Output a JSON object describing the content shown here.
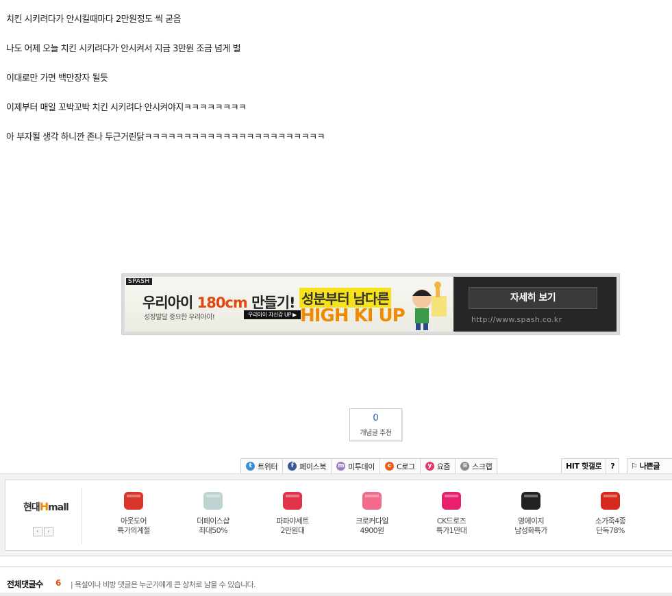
{
  "post": {
    "lines": [
      "치킨 시키려다가 안시킬때마다 2만원정도 씩 굳음",
      "나도 어제 오늘 치킨 시키려다가 안시켜서 지금 3만원 조금 넘게 벌",
      "이대로만 가면 백만장자 될듯",
      "이제부터 매일 꼬박꼬박 치킨 시키려다 안시켜야지ㅋㅋㅋㅋㅋㅋㅋㅋ",
      "아 부자될 생각 하니깐 존나 두근거린닭ㅋㅋㅋㅋㅋㅋㅋㅋㅋㅋㅋㅋㅋㅋㅋㅋㅋㅋㅋㅋㅋㅋㅋ"
    ]
  },
  "ad": {
    "logo": "SPASH",
    "headline_a": "우리아이 ",
    "headline_hl": "180cm",
    "headline_b": " 만들기!",
    "sub": "성장발달 중요한 우리아이!",
    "pill": "우리아이 자신감 UP ▶",
    "slogan": "성분부터 남다른",
    "brand_line": "HIGH KI UP",
    "cta": "자세히 보기",
    "url": "http://www.spash.co.kr"
  },
  "recommend": {
    "count": "0",
    "label": "개념글 추천"
  },
  "share": [
    {
      "label": "트위터",
      "icon": "twitter-icon",
      "color": "#3a8fd6",
      "glyph": "t"
    },
    {
      "label": "페이스북",
      "icon": "facebook-icon",
      "color": "#3b5998",
      "glyph": "f"
    },
    {
      "label": "미투데이",
      "icon": "me2day-icon",
      "color": "#9b7fc4",
      "glyph": "m"
    },
    {
      "label": "C로그",
      "icon": "clog-icon",
      "color": "#e5611c",
      "glyph": "c"
    },
    {
      "label": "요즘",
      "icon": "yozm-icon",
      "color": "#e23a6a",
      "glyph": "y"
    },
    {
      "label": "스크랩",
      "icon": "scrap-icon",
      "color": "#8a8a8a",
      "glyph": "≡"
    }
  ],
  "hit": {
    "gallery": "HIT 힛갤로",
    "help": "?"
  },
  "report": {
    "label": "나쁜글"
  },
  "mall": {
    "brand_a": "현대",
    "brand_h": "H",
    "brand_b": "mall",
    "prev": "‹",
    "next": "›",
    "products": [
      {
        "line1": "아웃도어",
        "line2": "특가의계절",
        "color": "#d8362b",
        "icon": "shoe-icon"
      },
      {
        "line1": "더페이스샵",
        "line2": "최대50%",
        "color": "#bfd3d3",
        "icon": "cosmetic-jar-icon"
      },
      {
        "line1": "파파야세트",
        "line2": "2만원대",
        "color": "#e0334a",
        "icon": "shirt-icon"
      },
      {
        "line1": "크로커다일",
        "line2": "4900원",
        "color": "#f26b8a",
        "icon": "tshirt-icon"
      },
      {
        "line1": "CK드로즈",
        "line2": "특가1만대",
        "color": "#e8206c",
        "icon": "underwear-icon"
      },
      {
        "line1": "영에이지",
        "line2": "남성화특가",
        "color": "#222222",
        "icon": "dress-shoe-icon"
      },
      {
        "line1": "소가죽4종",
        "line2": "단독78%",
        "color": "#d62a1e",
        "icon": "handbag-icon"
      }
    ]
  },
  "comments": {
    "title": "전체댓글수",
    "count": "6",
    "note": "| 욕설이나 비방 댓글은 누군가에게 큰 상처로 남을 수 있습니다."
  }
}
